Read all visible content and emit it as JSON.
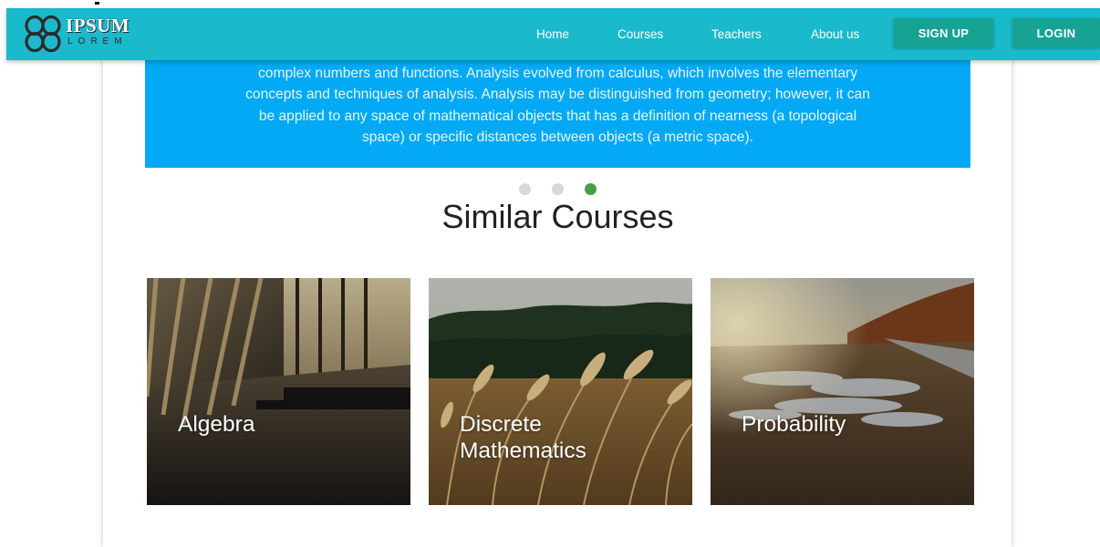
{
  "header": {
    "logo_main": "IPSUM",
    "logo_sub": "LOREM",
    "nav": [
      {
        "label": "Home"
      },
      {
        "label": "Courses"
      },
      {
        "label": "Teachers"
      },
      {
        "label": "About us"
      }
    ],
    "signup_label": "SIGN UP",
    "login_label": "LOGIN"
  },
  "banner": {
    "text": "complex numbers and functions. Analysis evolved from calculus, which involves the elementary concepts and techniques of analysis. Analysis may be distinguished from geometry; however, it can be applied to any space of mathematical objects that has a definition of nearness (a topological space) or specific distances between objects (a metric space)."
  },
  "carousel": {
    "dots": 3,
    "active_index": 2
  },
  "similar": {
    "title": "Similar Courses",
    "courses": [
      {
        "line1": "Algebra",
        "line2": ""
      },
      {
        "line1": "Discrete",
        "line2": "Mathematics"
      },
      {
        "line1": "Probability",
        "line2": ""
      }
    ]
  },
  "colors": {
    "navbar": "#1ab9cc",
    "nav_button": "#17a394",
    "banner": "#03a9f4",
    "dot_inactive": "#d8d8d8",
    "dot_active": "#43a047"
  },
  "icons": {
    "logo": "four-loop-flower-logo-icon"
  }
}
